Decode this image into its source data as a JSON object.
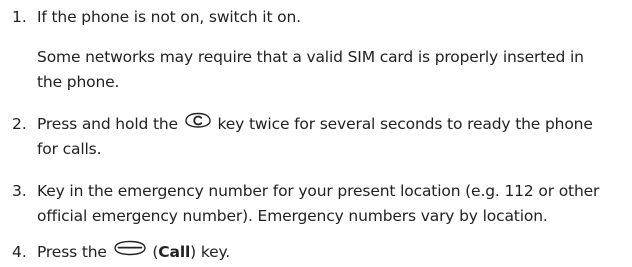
{
  "steps": [
    {
      "number": "1.",
      "lines": [
        "If the phone is not on, switch it on."
      ],
      "note_lines": [
        "Some networks may require that a valid SIM card is properly inserted in",
        "the phone."
      ]
    },
    {
      "number": "2.",
      "line1_before": "Press and hold the",
      "line1_icon": "clear-key-icon",
      "line1_after": "key twice for several seconds to ready the phone",
      "line2": "for calls."
    },
    {
      "number": "3.",
      "lines": [
        "Key in the emergency number for your present location (e.g. 112 or other",
        "official emergency number). Emergency numbers vary by location."
      ]
    },
    {
      "number": "4.",
      "line1_before": "Press the",
      "line1_icon": "call-key-icon",
      "paren_open": "(",
      "key_label": "Call",
      "paren_close": ") key."
    }
  ]
}
